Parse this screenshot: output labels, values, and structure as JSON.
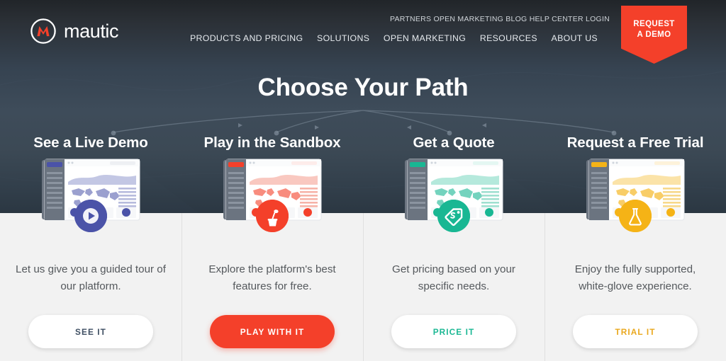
{
  "brand": {
    "name": "mautic",
    "logo_icon": "mautic-m-circle-icon",
    "accent_red": "#f4402a",
    "hero_dark": "#3e4c5a"
  },
  "header": {
    "utility_nav": [
      {
        "label": "PARTNERS",
        "name": "partners"
      },
      {
        "label": "OPEN MARKETING BLOG",
        "name": "open-marketing-blog"
      },
      {
        "label": "HELP CENTER",
        "name": "help-center"
      },
      {
        "label": "LOGIN",
        "name": "login"
      }
    ],
    "main_nav": [
      {
        "label": "PRODUCTS AND PRICING",
        "name": "products-and-pricing"
      },
      {
        "label": "SOLUTIONS",
        "name": "solutions"
      },
      {
        "label": "OPEN MARKETING",
        "name": "open-marketing"
      },
      {
        "label": "RESOURCES",
        "name": "resources"
      },
      {
        "label": "ABOUT US",
        "name": "about-us"
      }
    ],
    "demo_badge": {
      "line1": "REQUEST",
      "line2": "A DEMO",
      "color": "#f4402a"
    }
  },
  "hero": {
    "title": "Choose Your Path"
  },
  "cards": [
    {
      "heading": "See a Live Demo",
      "description": "Let us give you a guided tour of our platform.",
      "button_label": "SEE IT",
      "button_style": "light",
      "button_text_color": "#3f4f63",
      "accent": "#4b53a8",
      "icon": "play-circle-icon",
      "illustration": "dashboard-mockup-blue"
    },
    {
      "heading": "Play in the Sandbox",
      "description": "Explore the platform's best features for free.",
      "button_label": "PLAY WITH IT",
      "button_style": "solid",
      "button_text_color": "#ffffff",
      "accent": "#f4402a",
      "icon": "sandbox-bucket-shovel-icon",
      "illustration": "dashboard-mockup-red"
    },
    {
      "heading": "Get a Quote",
      "description": "Get pricing based on your specific needs.",
      "button_label": "PRICE IT",
      "button_style": "light",
      "button_text_color": "#1cb894",
      "accent": "#19b793",
      "icon": "price-tag-icon",
      "illustration": "dashboard-mockup-teal"
    },
    {
      "heading": "Request a Free Trial",
      "description": "Enjoy the fully supported, white-glove experience.",
      "button_label": "TRIAL IT",
      "button_style": "light",
      "button_text_color": "#eaa81e",
      "accent": "#f5b316",
      "icon": "flask-icon",
      "illustration": "dashboard-mockup-amber"
    }
  ]
}
